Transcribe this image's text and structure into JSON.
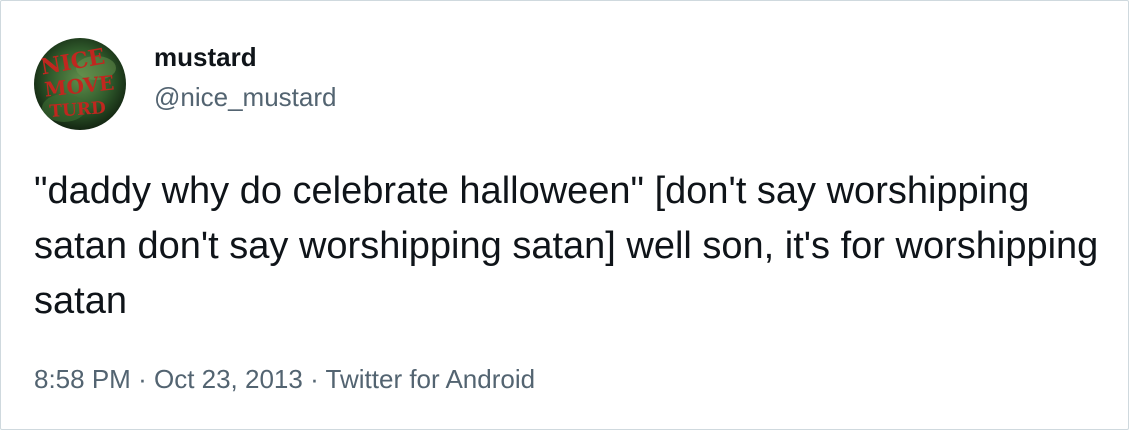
{
  "tweet": {
    "author": {
      "display_name": "mustard",
      "handle": "@nice_mustard",
      "avatar": {
        "icon": "avatar-image",
        "text_lines": [
          "NICE",
          "MOVE",
          "TURD"
        ]
      }
    },
    "text": "\"daddy why do celebrate halloween\" [don't say worshipping satan don't say worshipping satan] well son, it's for worshipping satan",
    "meta": {
      "time": "8:58 PM",
      "separator": "·",
      "date": "Oct 23, 2013",
      "source": "Twitter for Android"
    }
  },
  "colors": {
    "text_primary": "#0f1419",
    "text_secondary": "#536471",
    "border": "#cfd9de",
    "avatar_letters": "#c0271f",
    "avatar_background": "#2f5a2b"
  }
}
